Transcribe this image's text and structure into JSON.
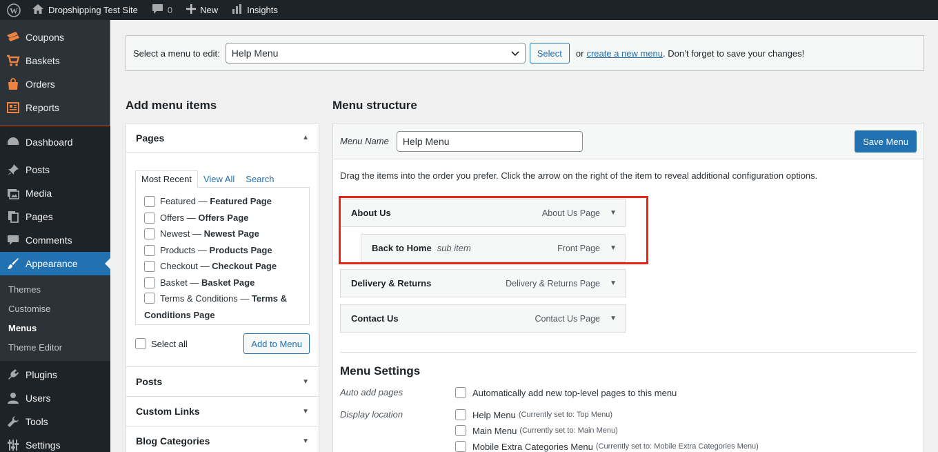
{
  "adminbar": {
    "site_name": "Dropshipping Test Site",
    "comments_count": "0",
    "new_label": "New",
    "insights_label": "Insights"
  },
  "sidebar": {
    "woocommerce_items": [
      {
        "label": "Coupons",
        "icon": "coupon-icon"
      },
      {
        "label": "Baskets",
        "icon": "cart-icon"
      },
      {
        "label": "Orders",
        "icon": "bag-icon"
      },
      {
        "label": "Reports",
        "icon": "report-icon"
      }
    ],
    "items": [
      {
        "label": "Dashboard",
        "icon": "dashboard-icon"
      },
      {
        "label": "Posts",
        "icon": "pin-icon"
      },
      {
        "label": "Media",
        "icon": "media-icon"
      },
      {
        "label": "Pages",
        "icon": "pages-icon"
      },
      {
        "label": "Comments",
        "icon": "comment-icon"
      },
      {
        "label": "Appearance",
        "icon": "brush-icon"
      }
    ],
    "appearance_sub": [
      "Themes",
      "Customise",
      "Menus",
      "Theme Editor"
    ],
    "items_after": [
      {
        "label": "Plugins",
        "icon": "plugin-icon"
      },
      {
        "label": "Users",
        "icon": "users-icon"
      },
      {
        "label": "Tools",
        "icon": "wrench-icon"
      },
      {
        "label": "Settings",
        "icon": "settings-icon"
      }
    ]
  },
  "manage": {
    "label": "Select a menu to edit:",
    "selected_menu": "Help Menu",
    "select_button": "Select",
    "or_text": "or",
    "create_link": "create a new menu",
    "reminder": ". Don’t forget to save your changes!"
  },
  "left": {
    "title": "Add menu items",
    "pages_section": "Pages",
    "tabs": [
      "Most Recent",
      "View All",
      "Search"
    ],
    "pages": [
      {
        "name": "Featured",
        "page": "Featured Page"
      },
      {
        "name": "Offers",
        "page": "Offers Page"
      },
      {
        "name": "Newest",
        "page": "Newest Page"
      },
      {
        "name": "Products",
        "page": "Products Page"
      },
      {
        "name": "Checkout",
        "page": "Checkout Page"
      },
      {
        "name": "Basket",
        "page": "Basket Page"
      },
      {
        "name": "Terms & Conditions",
        "page": "Terms & Conditions Page"
      }
    ],
    "dash": " — ",
    "select_all": "Select all",
    "add_button": "Add to Menu",
    "sections": [
      "Posts",
      "Custom Links",
      "Blog Categories"
    ]
  },
  "right": {
    "title": "Menu structure",
    "menu_name_label": "Menu Name",
    "menu_name_value": "Help Menu",
    "save_button": "Save Menu",
    "instructions": "Drag the items into the order you prefer. Click the arrow on the right of the item to reveal additional configuration options.",
    "items": [
      {
        "title": "About Us",
        "type": "About Us Page",
        "sub": ""
      },
      {
        "title": "Back to Home",
        "type": "Front Page",
        "sub": "sub item"
      },
      {
        "title": "Delivery & Returns",
        "type": "Delivery & Returns Page",
        "sub": ""
      },
      {
        "title": "Contact Us",
        "type": "Contact Us Page",
        "sub": ""
      }
    ],
    "settings_title": "Menu Settings",
    "auto_add_label": "Auto add pages",
    "auto_add_text": "Automatically add new top-level pages to this menu",
    "display_label": "Display location",
    "locations": [
      {
        "name": "Help Menu",
        "note": "(Currently set to: Top Menu)"
      },
      {
        "name": "Main Menu",
        "note": "(Currently set to: Main Menu)"
      },
      {
        "name": "Mobile Extra Categories Menu",
        "note": "(Currently set to: Mobile Extra Categories Menu)"
      }
    ]
  },
  "colors": {
    "admin_dark": "#1d2327",
    "accent_blue": "#2271b1",
    "woo_orange": "#f0823f",
    "highlight_red": "#e8251a"
  }
}
